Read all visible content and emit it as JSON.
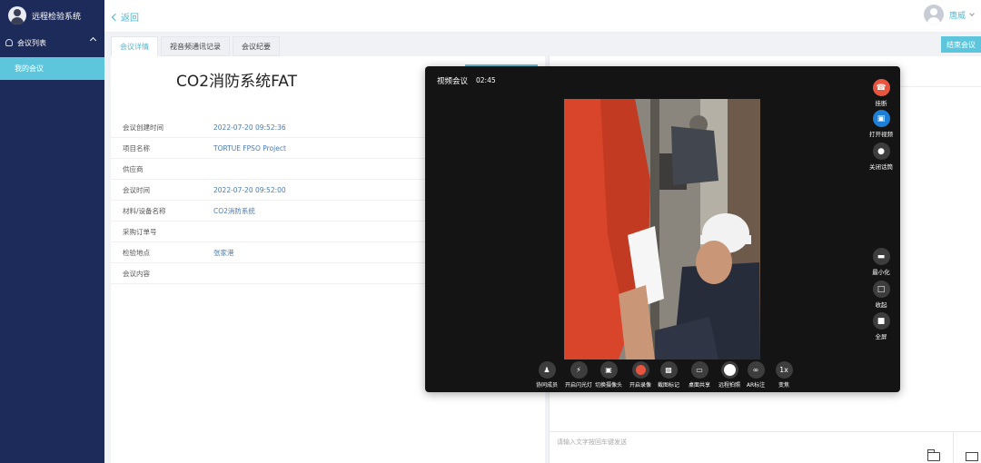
{
  "app": {
    "title": "远程检验系统"
  },
  "sidebar": {
    "group_label": "会议列表",
    "items": [
      {
        "label": "我的会议"
      }
    ]
  },
  "topbar": {
    "back_label": "返回",
    "user_name": "唐威"
  },
  "tabs": [
    {
      "label": "会议详情",
      "active": true
    },
    {
      "label": "视音频通讯记录",
      "active": false
    },
    {
      "label": "会议纪要",
      "active": false
    }
  ],
  "end_meeting_label": "结束会议",
  "meeting": {
    "title": "CO2消防系统FAT",
    "fields": [
      {
        "label": "会议创建时间",
        "value": "2022-07-20 09:52:36"
      },
      {
        "label": "项目名称",
        "value": "TORTUE FPSO Project"
      },
      {
        "label": "供应商",
        "value": ""
      },
      {
        "label": "会议时间",
        "value": "2022-07-20 09:52:00"
      },
      {
        "label": "材料/设备名称",
        "value": "CO2消防系统"
      },
      {
        "label": "采购订单号",
        "value": ""
      },
      {
        "label": "检验地点",
        "value": "张家港"
      },
      {
        "label": "会议内容",
        "value": ""
      }
    ]
  },
  "chat": {
    "placeholder": "请输入文字按回车键发送"
  },
  "video_call": {
    "title": "视频会议",
    "duration": "02:45",
    "side_controls_top": [
      {
        "label": "挂断",
        "icon": "hangup-icon",
        "color": "#e8553f"
      },
      {
        "label": "打开视频",
        "icon": "video-camera-icon",
        "color": "#1e7fd6"
      },
      {
        "label": "关闭话筒",
        "icon": "microphone-icon",
        "color": "#3d3d3d"
      }
    ],
    "side_controls_bottom": [
      {
        "label": "最小化",
        "icon": "minimize-icon"
      },
      {
        "label": "收起",
        "icon": "collapse-icon"
      },
      {
        "label": "全屏",
        "icon": "fullscreen-icon"
      }
    ],
    "bottom_controls": [
      {
        "label": "协同成员",
        "icon": "members-icon"
      },
      {
        "label": "开启闪光灯",
        "icon": "flash-icon"
      },
      {
        "label": "切换摄像头",
        "icon": "switch-camera-icon"
      },
      {
        "label": "开启录像",
        "icon": "record-icon"
      },
      {
        "label": "截图标记",
        "icon": "screenshot-mark-icon"
      },
      {
        "label": "桌面共享",
        "icon": "screen-share-icon"
      },
      {
        "label": "远程拍照",
        "icon": "remote-photo-icon"
      },
      {
        "label": "AR标注",
        "icon": "ar-annotate-icon"
      },
      {
        "label": "变焦",
        "icon": "zoom-icon",
        "text": "1x"
      }
    ]
  },
  "colors": {
    "accent": "#5ec6dc",
    "sidebar": "#1d2b5a",
    "hangup": "#e8553f",
    "video_on": "#1e7fd6"
  }
}
